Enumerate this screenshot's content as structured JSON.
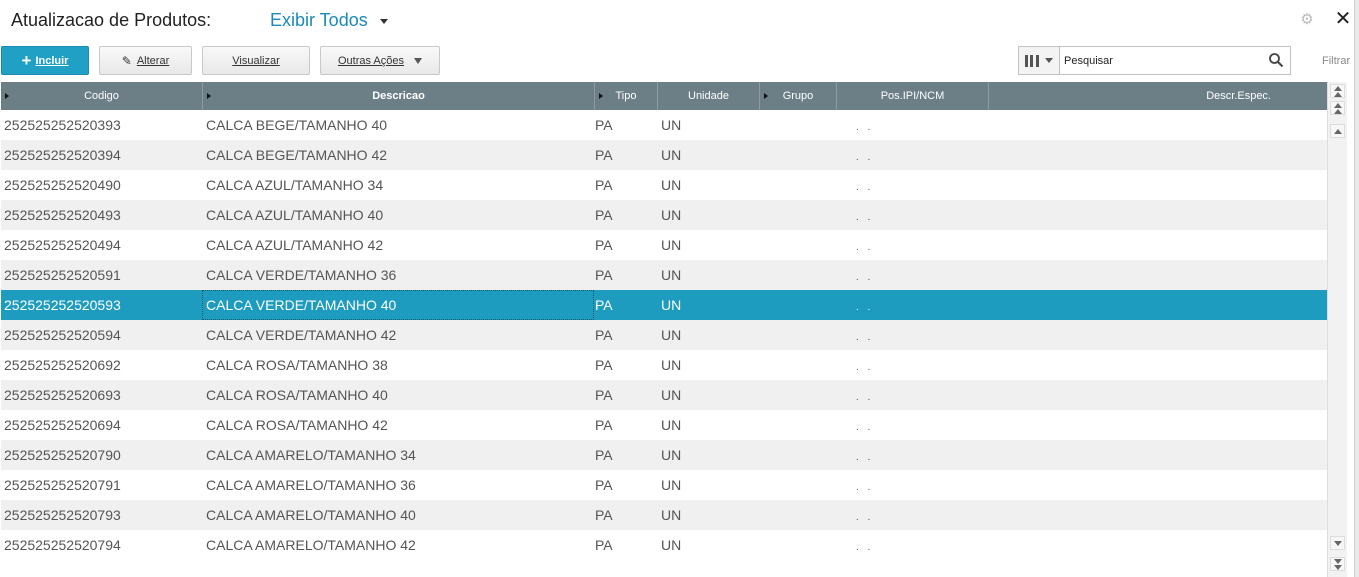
{
  "header": {
    "title": "Atualizacao de Produtos:",
    "view": "Exibir Todos"
  },
  "toolbar": {
    "incluir": "Incluir",
    "alterar": "Alterar",
    "visualizar": "Visualizar",
    "outras_acoes": "Outras Ações",
    "search_placeholder": "Pesquisar",
    "filtrar": "Filtrar"
  },
  "columns": [
    "Codigo",
    "Descricao",
    "Tipo",
    "Unidade",
    "Grupo",
    "Pos.IPI/NCM",
    "Descr.Espec."
  ],
  "rows": [
    {
      "codigo": "252525252520393",
      "descricao": "CALCA BEGE/TAMANHO 40",
      "tipo": "PA",
      "unidade": "UN",
      "ncm": ". ."
    },
    {
      "codigo": "252525252520394",
      "descricao": "CALCA BEGE/TAMANHO 42",
      "tipo": "PA",
      "unidade": "UN",
      "ncm": ". ."
    },
    {
      "codigo": "252525252520490",
      "descricao": "CALCA AZUL/TAMANHO 34",
      "tipo": "PA",
      "unidade": "UN",
      "ncm": ". ."
    },
    {
      "codigo": "252525252520493",
      "descricao": "CALCA AZUL/TAMANHO 40",
      "tipo": "PA",
      "unidade": "UN",
      "ncm": ". ."
    },
    {
      "codigo": "252525252520494",
      "descricao": "CALCA AZUL/TAMANHO 42",
      "tipo": "PA",
      "unidade": "UN",
      "ncm": ". ."
    },
    {
      "codigo": "252525252520591",
      "descricao": "CALCA VERDE/TAMANHO 36",
      "tipo": "PA",
      "unidade": "UN",
      "ncm": ". ."
    },
    {
      "codigo": "252525252520593",
      "descricao": "CALCA VERDE/TAMANHO 40",
      "tipo": "PA",
      "unidade": "UN",
      "ncm": ". ."
    },
    {
      "codigo": "252525252520594",
      "descricao": "CALCA VERDE/TAMANHO 42",
      "tipo": "PA",
      "unidade": "UN",
      "ncm": ". ."
    },
    {
      "codigo": "252525252520692",
      "descricao": "CALCA ROSA/TAMANHO 38",
      "tipo": "PA",
      "unidade": "UN",
      "ncm": ". ."
    },
    {
      "codigo": "252525252520693",
      "descricao": "CALCA ROSA/TAMANHO 40",
      "tipo": "PA",
      "unidade": "UN",
      "ncm": ". ."
    },
    {
      "codigo": "252525252520694",
      "descricao": "CALCA ROSA/TAMANHO 42",
      "tipo": "PA",
      "unidade": "UN",
      "ncm": ". ."
    },
    {
      "codigo": "252525252520790",
      "descricao": "CALCA AMARELO/TAMANHO 34",
      "tipo": "PA",
      "unidade": "UN",
      "ncm": ". ."
    },
    {
      "codigo": "252525252520791",
      "descricao": "CALCA AMARELO/TAMANHO 36",
      "tipo": "PA",
      "unidade": "UN",
      "ncm": ". ."
    },
    {
      "codigo": "252525252520793",
      "descricao": "CALCA AMARELO/TAMANHO 40",
      "tipo": "PA",
      "unidade": "UN",
      "ncm": ". ."
    },
    {
      "codigo": "252525252520794",
      "descricao": "CALCA AMARELO/TAMANHO 42",
      "tipo": "PA",
      "unidade": "UN",
      "ncm": ". ."
    }
  ],
  "selected_row": 6,
  "colors": {
    "accent": "#1e9cbf",
    "header_bg": "#6c7f86"
  },
  "icons": {
    "gear": "gear-icon",
    "close": "close-icon",
    "search": "search-icon",
    "columns": "columns-icon"
  }
}
